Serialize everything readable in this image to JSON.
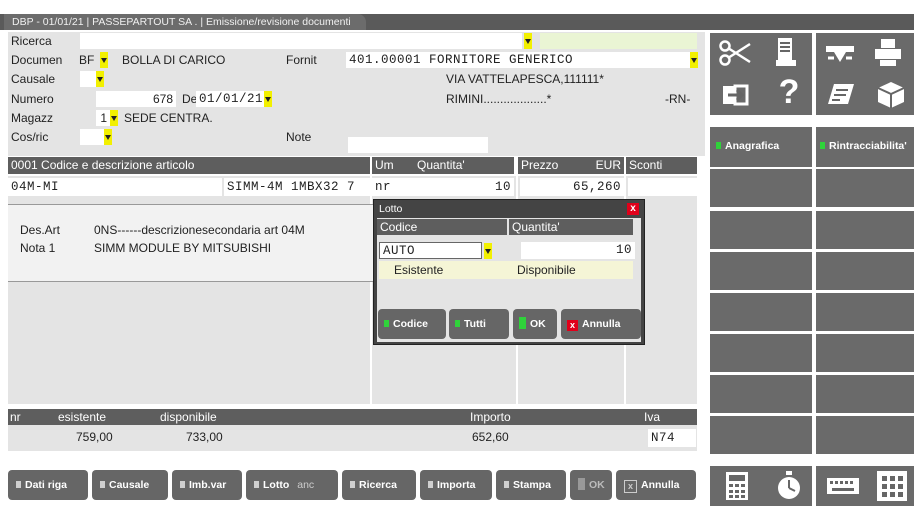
{
  "window": {
    "title": "DBP - 01/01/21 | PASSEPARTOUT SA . | Emissione/revisione documenti"
  },
  "form": {
    "ricerca_label": "Ricerca",
    "documen_label": "Documen",
    "documen_code": "BF",
    "documen_desc": "BOLLA DI CARICO",
    "fornit_label": "Fornit",
    "fornit_value": "401.00001 FORNITORE GENERICO",
    "address1": "VIA VATTELAPESCA,111111*",
    "address2": "RIMINI...................*",
    "province": "-RN-",
    "causale_label": "Causale",
    "numero_label": "Numero",
    "numero_value": "678",
    "del_label": "Del",
    "del_value": "01/01/21",
    "magazz_label": "Magazz",
    "magazz_value": "1",
    "magazz_desc": "SEDE CENTRA.",
    "cosric_label": "Cos/ric",
    "note_label": "Note"
  },
  "grid": {
    "headers": {
      "codice": "0001 Codice e descrizione articolo",
      "um": "Um",
      "quantita": "Quantita'",
      "prezzo": "Prezzo",
      "eur": "EUR",
      "sconti": "Sconti"
    },
    "row": {
      "codice": "04M-MI",
      "desc": "SIMM-4M 1MBX32 7",
      "um": "nr",
      "quantita": "10",
      "prezzo": "65,260"
    }
  },
  "desart": {
    "desart_label": "Des.Art",
    "desart_value": "0NS------descrizionesecondaria art 04M",
    "nota_label": "Nota 1",
    "nota_value": "SIMM MODULE BY MITSUBISHI"
  },
  "footer": {
    "nr": "nr",
    "esistente_label": "esistente",
    "disponibile_label": "disponibile",
    "importo_label": "Importo",
    "iva_label": "Iva",
    "esistente_value": "759,00",
    "disponibile_value": "733,00",
    "importo_value": "652,60",
    "iva_value": "N74"
  },
  "lotto_dialog": {
    "title": "Lotto",
    "col_codice": "Codice",
    "col_quantita": "Quantita'",
    "codice_value": "AUTO",
    "quantita_value": "10",
    "esistente_label": "Esistente",
    "disponibile_label": "Disponibile",
    "btn_codice": "Codice",
    "btn_tutti": "Tutti",
    "btn_ok": "OK",
    "btn_annulla": "Annulla"
  },
  "right_panel": {
    "tab_anagrafica": "Anagrafica",
    "tab_rintracciabilita": "Rintracciabilita'"
  },
  "toolbar": {
    "dati_riga": "Dati riga",
    "causale": "Causale",
    "imb_var": "Imb.var",
    "lotto": "Lotto",
    "anc": "anc",
    "ricerca": "Ricerca",
    "importa": "Importa",
    "stampa": "Stampa",
    "ok": "OK",
    "annulla": "Annulla"
  },
  "colors": {
    "accent_yellow": "#f2f000",
    "green": "#2fd23a",
    "red": "#e0001a",
    "panel": "#6a6a6a"
  }
}
